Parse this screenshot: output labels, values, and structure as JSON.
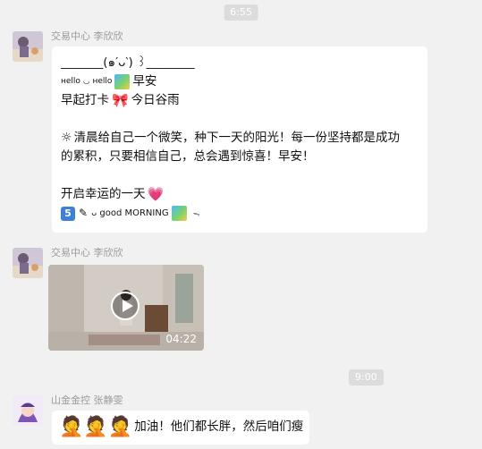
{
  "timestamps": [
    "6:55",
    "9:00"
  ],
  "messages": [
    {
      "sender": "交易中心 李欣欣",
      "lines": {
        "l1": "_______(๑′ᴗ‵) ꒱________",
        "l2_small": "ʜello ◡ ʜello",
        "l2_text": "早安",
        "l3_a": "早起打卡",
        "l3_b": "今日谷雨",
        "l4": "清晨给自己一个微笑，种下一天的阳光！每一份坚持都是成功",
        "l5": "的累积，只要相信自己，总会遇到惊喜！早安！",
        "l6": "开启幸运的一天",
        "l7_five": "5",
        "l7_text": "ᴗ good MORNING",
        "l7_end": "ᯓ"
      }
    },
    {
      "sender": "交易中心 李欣欣",
      "video": {
        "duration": "04:22"
      }
    },
    {
      "sender": "山金金控 张静雯",
      "text": "加油！他们都长胖，然后咱们瘦"
    }
  ],
  "icons": [
    "rainbow-icon",
    "bow-icon",
    "sun-icon",
    "heart-icon",
    "pencil-icon",
    "play-icon",
    "facepalm-emoji-icon"
  ],
  "colors": {
    "background": "#f1f1f1",
    "bubble": "#ffffff",
    "timestamp": "#dcdcdc",
    "sender": "#9a9a9a"
  }
}
